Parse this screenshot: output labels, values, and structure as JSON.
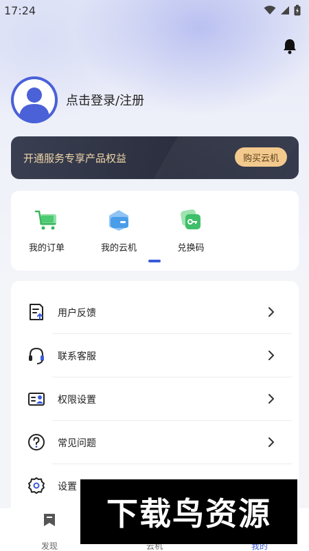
{
  "status_bar": {
    "time": "17:24"
  },
  "profile": {
    "login_text": "点击登录/注册"
  },
  "vip_banner": {
    "text": "开通服务专享产品权益",
    "button_label": "购买云机"
  },
  "quick_actions": [
    {
      "label": "我的订单",
      "icon": "cart-icon"
    },
    {
      "label": "我的云机",
      "icon": "cloud-phone-icon"
    },
    {
      "label": "兑换码",
      "icon": "key-icon"
    }
  ],
  "menu": [
    {
      "label": "用户反馈",
      "icon": "feedback-icon"
    },
    {
      "label": "联系客服",
      "icon": "headset-icon"
    },
    {
      "label": "权限设置",
      "icon": "permission-icon"
    },
    {
      "label": "常见问题",
      "icon": "question-icon"
    },
    {
      "label": "设置",
      "icon": "gear-icon"
    }
  ],
  "tabs": [
    {
      "label": "发现",
      "icon": "discover-icon"
    },
    {
      "label": "云机",
      "icon": "cloud-icon"
    },
    {
      "label": "我的",
      "icon": "profile-icon",
      "active": true
    }
  ],
  "watermark": {
    "text": "下载鸟资源"
  },
  "colors": {
    "accent": "#3a5bd9",
    "banner_bg": "#2f3344",
    "banner_text": "#f0d6a8",
    "banner_button": "#f3ca8d"
  }
}
